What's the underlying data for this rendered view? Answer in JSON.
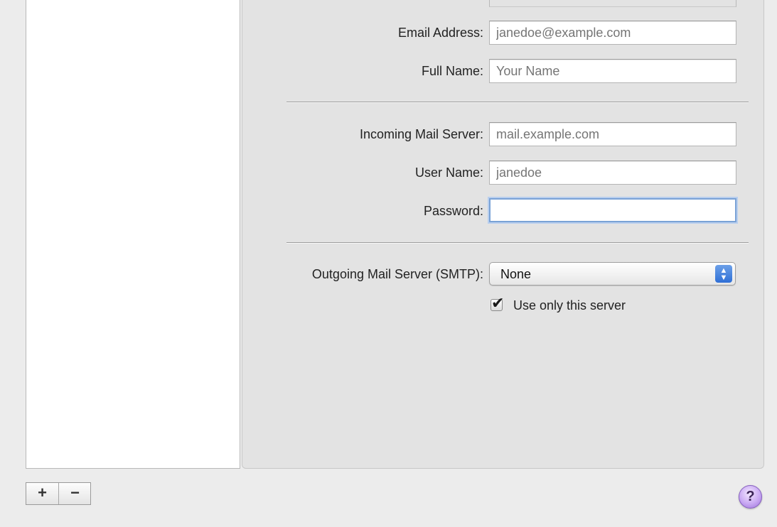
{
  "form": {
    "email_label": "Email Address:",
    "email_placeholder": "janedoe@example.com",
    "full_name_label": "Full Name:",
    "full_name_placeholder": "Your Name",
    "incoming_server_label": "Incoming Mail Server:",
    "incoming_server_placeholder": "mail.example.com",
    "user_name_label": "User Name:",
    "user_name_placeholder": "janedoe",
    "password_label": "Password:",
    "password_value": "",
    "smtp_label": "Outgoing Mail Server (SMTP):",
    "smtp_selected": "None",
    "use_only_label": "Use only this server",
    "use_only_checked": true
  },
  "toolbar": {
    "add_label": "+",
    "remove_label": "−",
    "help_label": "?"
  },
  "icons": {
    "add": "plus-icon",
    "remove": "minus-icon",
    "help": "question-mark-icon",
    "select_arrows": "up-down-arrows-icon",
    "checkmark": "checkmark-icon"
  },
  "colors": {
    "focus_ring": "#7aa2d6",
    "select_arrow_bg": "#2f6fd6",
    "help_button": "#c9a9f3"
  }
}
